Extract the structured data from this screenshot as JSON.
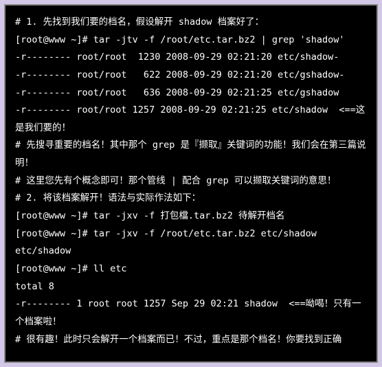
{
  "terminal": {
    "lines": [
      "# 1. 先找到我们要的档名，假设解开 shadow 档案好了：",
      "[root@www ~]# tar -jtv -f /root/etc.tar.bz2 | grep 'shadow'",
      "-r-------- root/root  1230 2008-09-29 02:21:20 etc/shadow-",
      "-r-------- root/root   622 2008-09-29 02:21:20 etc/gshadow-",
      "-r-------- root/root   636 2008-09-29 02:21:25 etc/gshadow",
      "-r-------- root/root 1257 2008-09-29 02:21:25 etc/shadow  <==这是我们要的！",
      "# 先搜寻重要的档名！其中那个 grep 是『撷取』关键词的功能！我们会在第三篇说明！",
      "# 这里您先有个概念即可！那个管线 | 配合 grep 可以撷取关键词的意思！",
      "",
      "# 2. 将该档案解开！语法与实际作法如下：",
      "[root@www ~]# tar -jxv -f 打包檔.tar.bz2 待解开档名",
      "[root@www ~]# tar -jxv -f /root/etc.tar.bz2 etc/shadow",
      "etc/shadow",
      "[root@www ~]# ll etc",
      "total 8",
      "-r-------- 1 root root 1257 Sep 29 02:21 shadow  <==呦喝！只有一个档案啦！",
      "# 很有趣！此时只会解开一个档案而已！不过，重点是那个档名！你要找到正确"
    ]
  }
}
